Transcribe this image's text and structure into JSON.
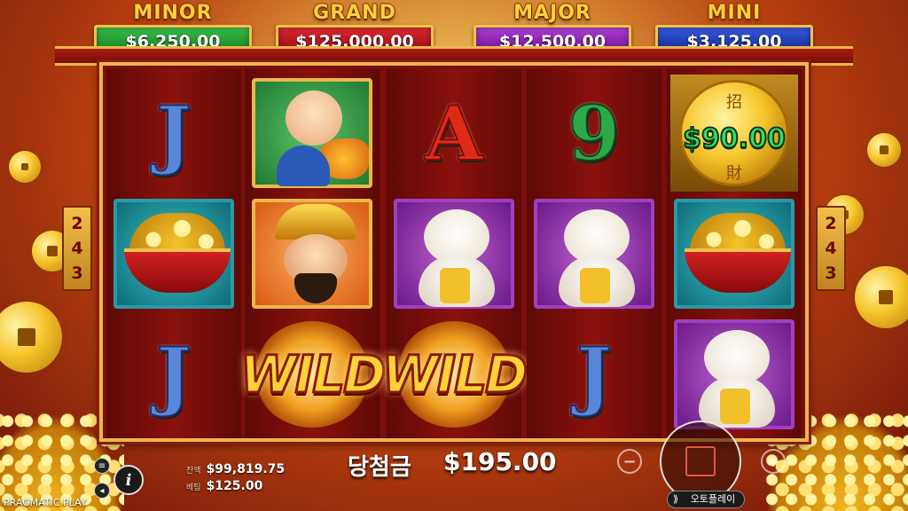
{
  "jackpots": [
    {
      "name": "MINOR",
      "value": "$6,250.00",
      "color": "#1f9a2a"
    },
    {
      "name": "GRAND",
      "value": "$125,000.00",
      "color": "#b8101a"
    },
    {
      "name": "MAJOR",
      "value": "$12,500.00",
      "color": "#8a1ab0"
    },
    {
      "name": "MINI",
      "value": "$3,125.00",
      "color": "#1a3ab8"
    }
  ],
  "ways": {
    "left": [
      "2",
      "4",
      "3"
    ],
    "right": [
      "2",
      "4",
      "3"
    ]
  },
  "reels": [
    [
      "J",
      "gold-coin-bowl",
      "J"
    ],
    [
      "fortune-boy-with-fish",
      "fortune-god",
      "WILD"
    ],
    [
      "A",
      "lucky-cat",
      "WILD"
    ],
    [
      "9",
      "lucky-cat",
      "J"
    ],
    [
      "coin-value",
      "gold-coin-bowl",
      "lucky-cat"
    ]
  ],
  "symbols": {
    "j": "J",
    "a": "A",
    "nine": "9",
    "wild": "WILD",
    "coin_top": "招",
    "coin_bottom": "財",
    "coin_value": "$90.00"
  },
  "bottom": {
    "win_label": "당첨금",
    "win_amount": "$195.00",
    "balance_label": "잔액",
    "balance": "$99,819.75",
    "bet_label": "베팅",
    "bet": "$125.00",
    "info": "i",
    "minus": "−",
    "plus": "+",
    "autoplay": "오토플레이",
    "brand": "PRAGMATIC PLAY"
  }
}
